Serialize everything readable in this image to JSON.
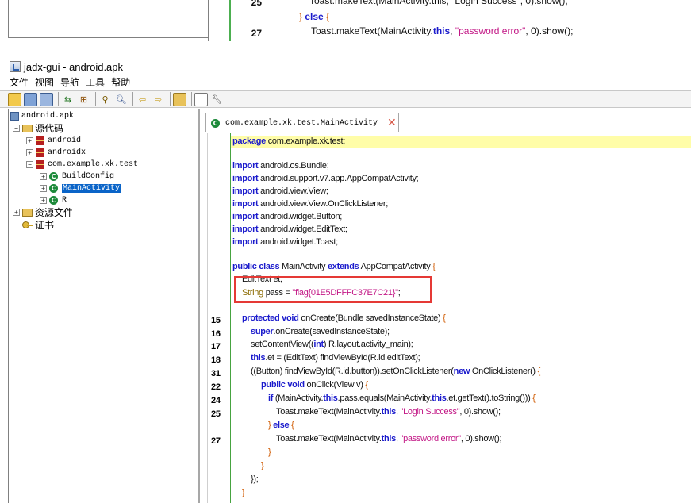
{
  "top_strip": {
    "line_numbers": [
      "25",
      "27"
    ],
    "lines": [
      "Toast.makeText(MainActivity.this, \"Login Success\", 0).show();",
      "} else {",
      "Toast.makeText(MainActivity.this, \"password error\", 0).show();"
    ]
  },
  "window": {
    "title": "jadx-gui - android.apk"
  },
  "menu": {
    "items": [
      "文件",
      "视图",
      "导航",
      "工具",
      "帮助"
    ]
  },
  "toolbar": {
    "icons": [
      "open-icon",
      "save-icon",
      "save-all-icon",
      "sync-icon",
      "flatten-icon",
      "find-icon",
      "search-icon",
      "back-icon",
      "forward-icon",
      "decompile-icon",
      "log-icon",
      "preferences-icon"
    ]
  },
  "tree": {
    "root": "android.apk",
    "source": "源代码",
    "packages": [
      "android",
      "androidx",
      "com.example.xk.test"
    ],
    "classes": [
      "BuildConfig",
      "MainActivity",
      "R"
    ],
    "resources": "资源文件",
    "certificate": "证书"
  },
  "editor": {
    "tab_label": "com.example.xk.test.MainActivity",
    "tab_close": "✕",
    "code": {
      "package_kw": "package",
      "package_name": " com.example.xk.test;",
      "import_kw": "import",
      "imports": [
        " android.os.Bundle;",
        " android.support.v7.app.AppCompatActivity;",
        " android.view.View;",
        " android.view.View.OnClickListener;",
        " android.widget.Button;",
        " android.widget.EditText;",
        " android.widget.Toast;"
      ],
      "class_decl_kw1": "public class",
      "class_name": " MainActivity ",
      "class_decl_kw2": "extends",
      "class_super": " AppCompatActivity ",
      "field1": "EditText et;",
      "field2_type": "String",
      "field2_rest": " pass = ",
      "field2_value": "\"flag{01E5DFFFC37E7C21}\"",
      "field2_end": ";",
      "oncreate_kw": "protected void",
      "oncreate_rest": " onCreate(Bundle savedInstanceState) ",
      "super_kw": "super",
      "super_rest": ".onCreate(savedInstanceState);",
      "setcontent_pre": "setContentView((",
      "int_kw": "int",
      "setcontent_post": ") R.layout.activity_main);",
      "this_kw": "this",
      "et_rest": ".et = (EditText) findViewById(R.id.editText);",
      "button_pre": "((Button) findViewById(R.id.button)).setOnClickListener(",
      "new_kw": "new",
      "button_post": " OnClickListener() ",
      "onclick_kw": "public void",
      "onclick_rest": " onClick(View v) ",
      "if_kw": "if",
      "if_pre": " (MainActivity.",
      "if_mid": ".pass.equals(MainActivity.",
      "if_post": ".et.getText().toString())) ",
      "toast_pre": "Toast.makeText(MainActivity.",
      "toast_login": "\"Login Success\"",
      "toast_error": "\"password error\"",
      "toast_post": ", 0).show();",
      "else_kw": "else",
      "close_anon": "});"
    },
    "line_numbers": [
      "15",
      "16",
      "17",
      "18",
      "31",
      "22",
      "24",
      "25",
      "27"
    ]
  },
  "colors": {
    "keyword": "#1a1acc",
    "string": "#c21685",
    "highlight": "#fffda8",
    "annotation_box": "#e53935",
    "selection": "#0a64c8"
  }
}
